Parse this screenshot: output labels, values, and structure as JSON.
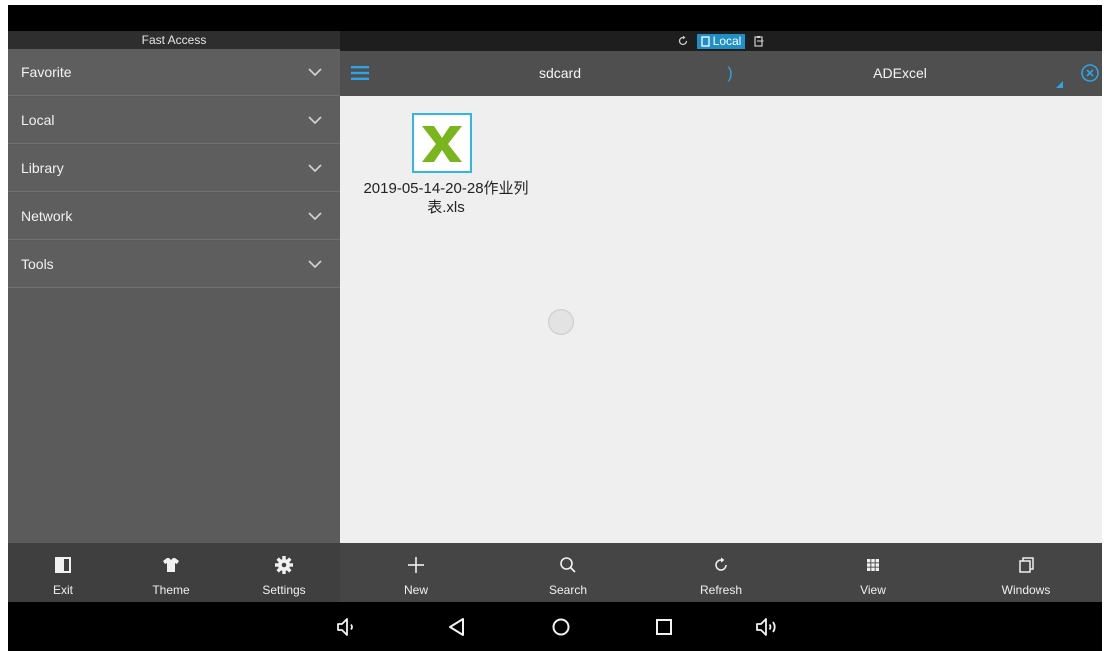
{
  "left_panel": {
    "header": "Fast Access",
    "sections": [
      {
        "label": "Favorite"
      },
      {
        "label": "Local"
      },
      {
        "label": "Library"
      },
      {
        "label": "Network"
      },
      {
        "label": "Tools"
      }
    ]
  },
  "location_bar": {
    "active_tab": "Local",
    "icons": [
      "refresh-small-icon",
      "device-icon",
      "clipboard-icon"
    ]
  },
  "path_bar": {
    "crumbs": [
      "sdcard",
      "ADExcel"
    ],
    "separator": ")"
  },
  "files": [
    {
      "name": "2019-05-14-20-28作业列表.xls",
      "icon": "excel-file-icon"
    }
  ],
  "left_toolbar": [
    {
      "label": "Exit",
      "icon": "exit-icon"
    },
    {
      "label": "Theme",
      "icon": "shirt-icon"
    },
    {
      "label": "Settings",
      "icon": "gear-icon"
    }
  ],
  "right_toolbar": [
    {
      "label": "New",
      "icon": "plus-icon"
    },
    {
      "label": "Search",
      "icon": "search-icon"
    },
    {
      "label": "Refresh",
      "icon": "refresh-icon"
    },
    {
      "label": "View",
      "icon": "grid-icon"
    },
    {
      "label": "Windows",
      "icon": "windows-icon"
    }
  ],
  "navbar": [
    "volume-down-icon",
    "back-icon",
    "home-icon",
    "recents-icon",
    "volume-up-icon"
  ],
  "colors": {
    "accent": "#2ea3e6",
    "local_tab": "#1f8fc6",
    "excel_green": "#7ab51d",
    "left_panel": "#5e5e5e",
    "content_bg": "#efefef"
  }
}
